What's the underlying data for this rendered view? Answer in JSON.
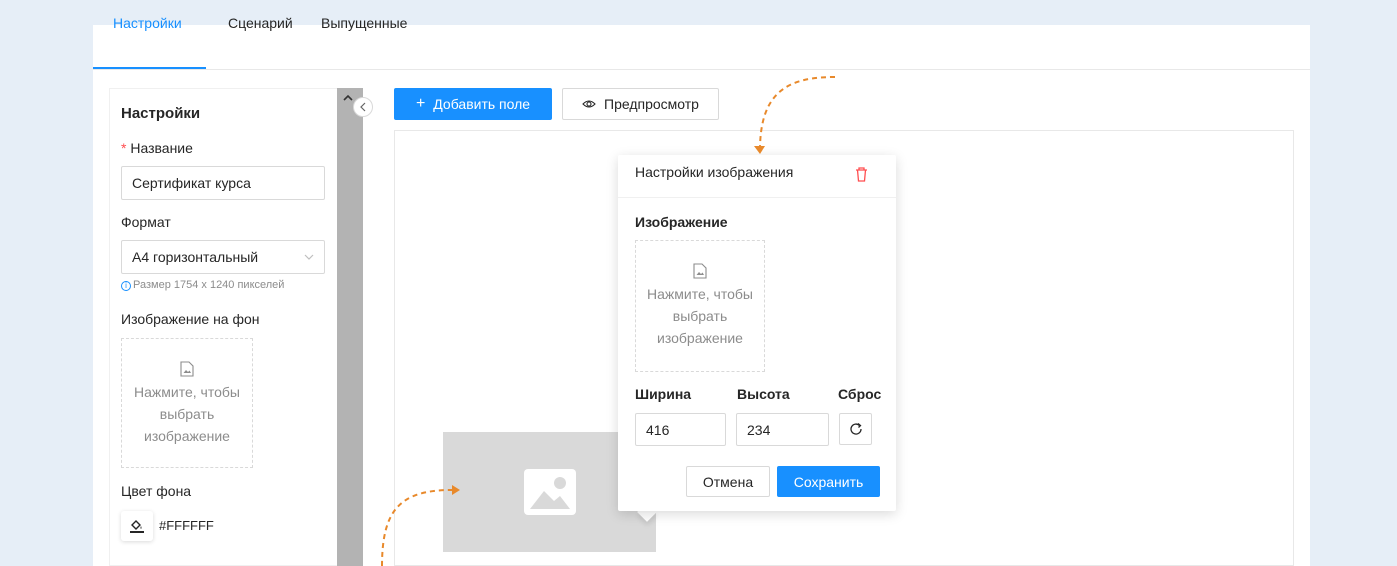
{
  "tabs": [
    "Настройки",
    "Сценарий",
    "Выпущенные"
  ],
  "settings": {
    "heading": "Настройки",
    "required_mark": "*",
    "name_label": "Название",
    "name_value": "Сертификат курса",
    "format_label": "Формат",
    "format_value": "A4 горизонтальный",
    "format_hint": "Размер 1754 x 1240 пикселей",
    "bg_image_label": "Изображение на фон",
    "upload_text": [
      "Нажмите, чтобы",
      "выбрать",
      "изображение"
    ],
    "bg_color_label": "Цвет фона",
    "bg_color_value": "#FFFFFF"
  },
  "toolbar": {
    "add_field": "Добавить поле",
    "add_icon": "+",
    "preview": "Предпросмотр"
  },
  "image_popup": {
    "title": "Настройки изображения",
    "section": "Изображение",
    "upload_text": [
      "Нажмите, чтобы",
      "выбрать",
      "изображение"
    ],
    "width_label": "Ширина",
    "height_label": "Высота",
    "reset_label": "Сброс",
    "width_value": "416",
    "height_value": "234",
    "cancel": "Отмена",
    "save": "Сохранить"
  },
  "colors": {
    "accent": "#1890ff",
    "annotation": "#e8892b",
    "danger": "#ff4d4f"
  }
}
